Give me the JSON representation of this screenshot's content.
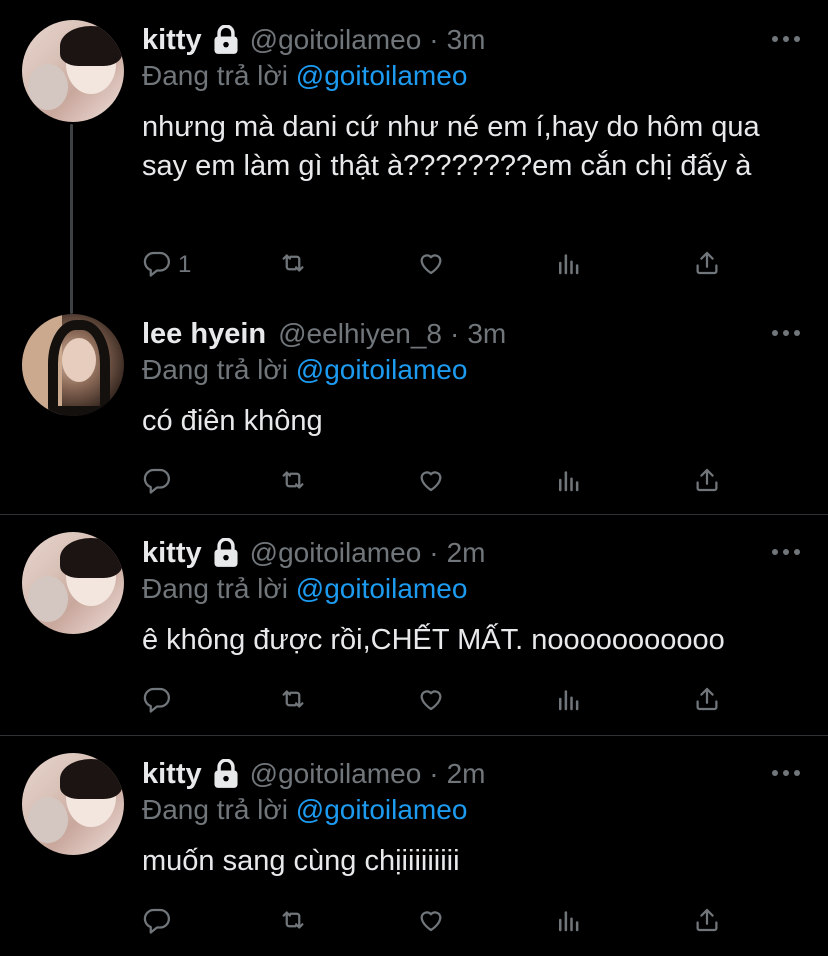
{
  "colors": {
    "background": "#000000",
    "text": "#e7e9ea",
    "muted": "#71767b",
    "link": "#1d9bf0",
    "divider": "#2f3336"
  },
  "tweets": [
    {
      "name": "kitty",
      "locked": true,
      "handle": "@goitoilameo",
      "time": "3m",
      "reply_prefix": "Đang trả lời",
      "reply_to": "@goitoilameo",
      "text": "nhưng mà dani cứ như né em í,hay do hôm qua say em làm gì thật à????????em cắn chị đấy à",
      "reply_count": "1"
    },
    {
      "name": "lee hyein",
      "locked": false,
      "handle": "@eelhiyen_8",
      "time": "3m",
      "reply_prefix": "Đang trả lời",
      "reply_to": "@goitoilameo",
      "text": "có điên không",
      "reply_count": ""
    },
    {
      "name": "kitty",
      "locked": true,
      "handle": "@goitoilameo",
      "time": "2m",
      "reply_prefix": "Đang trả lời",
      "reply_to": "@goitoilameo",
      "text": "ê không được rồi,CHẾT MẤT. nooooooooooo",
      "reply_count": ""
    },
    {
      "name": "kitty",
      "locked": true,
      "handle": "@goitoilameo",
      "time": "2m",
      "reply_prefix": "Đang trả lời",
      "reply_to": "@goitoilameo",
      "text": "muốn sang cùng chịiiiiiiiii",
      "reply_count": ""
    }
  ],
  "icons": {
    "reply": "reply-icon",
    "retweet": "retweet-icon",
    "like": "heart-icon",
    "analytics": "analytics-icon",
    "share": "share-icon",
    "more": "more-icon",
    "lock": "lock-icon"
  }
}
